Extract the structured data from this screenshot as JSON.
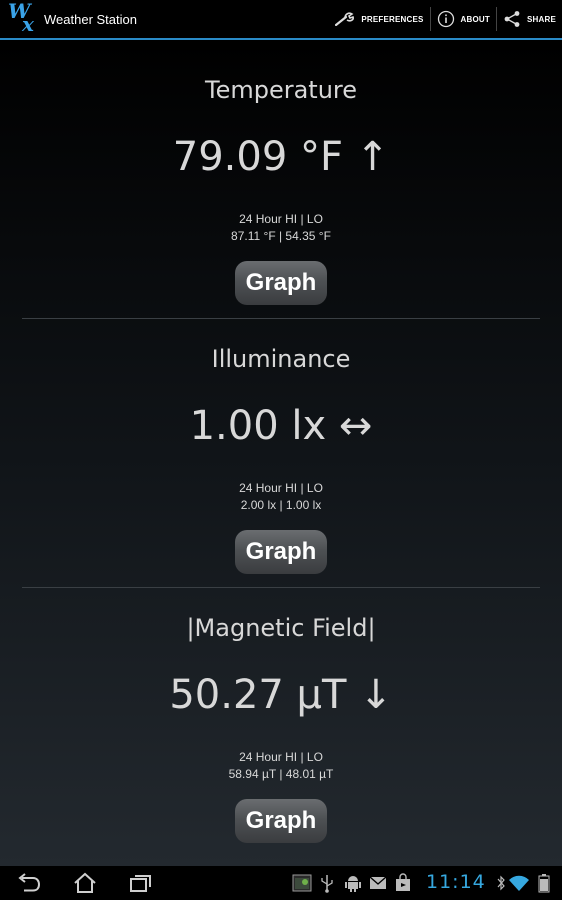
{
  "app": {
    "title": "Weather Station",
    "logo_letters": [
      "W",
      "x"
    ],
    "accent": "#2a8bc7"
  },
  "actions": [
    {
      "label": "PREFERENCES",
      "icon": "wrench-icon"
    },
    {
      "label": "ABOUT",
      "icon": "info-icon"
    },
    {
      "label": "SHARE",
      "icon": "share-icon"
    }
  ],
  "sections": [
    {
      "title": "Temperature",
      "reading": "79.09 °F ↑",
      "hilo_label": "24 Hour HI | LO",
      "hilo_values": "87.11 °F | 54.35 °F",
      "button": "Graph"
    },
    {
      "title": "Illuminance",
      "reading": "1.00 lx ↔",
      "hilo_label": "24 Hour HI | LO",
      "hilo_values": "2.00 lx | 1.00 lx",
      "button": "Graph"
    },
    {
      "title": "|Magnetic Field|",
      "reading": "50.27 µT ↓",
      "hilo_label": "24 Hour HI | LO",
      "hilo_values": "58.94 µT | 48.01 µT",
      "button": "Graph"
    }
  ],
  "system_bar": {
    "nav_icons": [
      "back-icon",
      "home-icon",
      "recent-apps-icon"
    ],
    "status_icons": [
      "screenshot-icon",
      "usb-icon",
      "android-debug-icon",
      "gmail-icon",
      "shopping-bag-icon",
      "wifi-icon",
      "bluetooth-icon",
      "battery-icon"
    ],
    "clock": "11:14",
    "clock_color": "#36a8e0"
  }
}
